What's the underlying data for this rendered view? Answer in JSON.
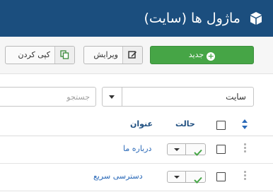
{
  "header": {
    "title": "ماژول ها (سایت)",
    "icon": "cube-icon"
  },
  "toolbar": {
    "new_label": "جدید",
    "edit_label": "ویرایش",
    "copy_label": "کپی کردن"
  },
  "filters": {
    "client_value": "سایت",
    "search_placeholder": "جستجو"
  },
  "table": {
    "columns": {
      "status": "حالت",
      "title": "عنوان"
    },
    "rows": [
      {
        "title": "درباره ما",
        "published": true
      },
      {
        "title": "دسترسی سریع",
        "published": true
      }
    ]
  },
  "colors": {
    "header_bg": "#1b4e7e",
    "new_button": "#46a546",
    "link": "#2a69b8",
    "check_green": "#46a546"
  }
}
